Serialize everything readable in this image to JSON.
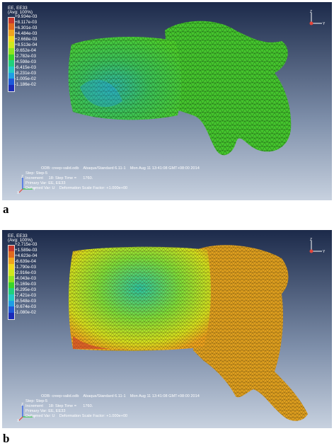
{
  "panels": [
    {
      "id": "a",
      "caption": "a",
      "legend": {
        "title_line1": "EE, EE33",
        "title_line2": "(Avg: 100%)",
        "values": [
          "+9.934e-03",
          "+8.117e-03",
          "+6.301e-03",
          "+4.484e-03",
          "+2.668e-03",
          "+8.513e-04",
          "-9.652e-04",
          "-2.782e-03",
          "-4.598e-03",
          "-6.415e-03",
          "-8.231e-03",
          "-1.005e-02",
          "-1.186e-02"
        ],
        "colors": [
          "#c8372b",
          "#e06a1e",
          "#f0a41e",
          "#f2d81c",
          "#cfe81d",
          "#8fe41f",
          "#3ad52a",
          "#20d07c",
          "#22c9c4",
          "#1f9ee4",
          "#1d58d9",
          "#1a2bb8"
        ]
      },
      "info": {
        "odb": "ODB: creep-valid.odb    Abaqus/Standard 6.11-1    Mon Aug 11 13:41:08 GMT+08:00 2014",
        "step": "Step: Step-5",
        "increment": "Increment     18: Step Time =      1760.",
        "primary": "Primary Var: EE, EE33",
        "deformed": "Deformed Var: U    Deformation Scale Factor: +1.000e+00"
      }
    },
    {
      "id": "b",
      "caption": "b",
      "legend": {
        "title_line1": "EE, EE33",
        "title_line2": "(Avg: 100%)",
        "values": [
          "+2.715e-03",
          "+1.589e-03",
          "+4.623e-04",
          "-6.639e-04",
          "-1.790e-03",
          "-2.916e-03",
          "-4.043e-03",
          "-5.169e-03",
          "-6.295e-03",
          "-7.421e-03",
          "-8.548e-03",
          "-9.674e-03",
          "-1.080e-02"
        ],
        "colors": [
          "#c8372b",
          "#e06a1e",
          "#f0a41e",
          "#f2d81c",
          "#cfe81d",
          "#8fe41f",
          "#3ad52a",
          "#20d07c",
          "#22c9c4",
          "#1f9ee4",
          "#1d58d9",
          "#1a2bb8"
        ]
      },
      "info": {
        "odb": "ODB: creep-valid.odb    Abaqus/Standard 6.11-1    Mon Aug 11 13:41:08 GMT+08:00 2014",
        "step": "Step: Step-5",
        "increment": "Increment     18: Step Time =      1760.",
        "primary": "Primary Var: EE, EE33",
        "deformed": "Deformed Var: U    Deformation Scale Factor: +1.000e+00"
      }
    }
  ],
  "axes": {
    "y": "Y",
    "z": "Z",
    "x": "X"
  }
}
